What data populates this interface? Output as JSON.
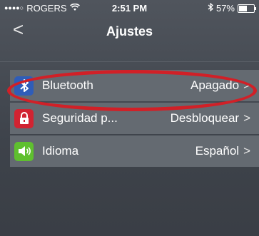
{
  "status_bar": {
    "carrier": "ROGERS",
    "time": "2:51 PM",
    "battery": "57%",
    "battery_level": 0.57,
    "icons": [
      "signal-dots-icon",
      "wifi-icon",
      "bluetooth-icon",
      "battery-icon"
    ]
  },
  "nav": {
    "back_icon": "chevron-left-icon",
    "title": "Ajustes"
  },
  "settings": [
    {
      "label": "Bluetooth",
      "value": "Apagado",
      "icon": "bluetooth-icon",
      "icon_color": "#2f5db8"
    },
    {
      "label": "Seguridad p...",
      "value": "Desbloquear",
      "icon": "lock-icon",
      "icon_color": "#d12331"
    },
    {
      "label": "Idioma",
      "value": "Español",
      "icon": "speaker-icon",
      "icon_color": "#5fbf2f"
    }
  ],
  "chevron": ">",
  "highlight_color": "#d12027"
}
